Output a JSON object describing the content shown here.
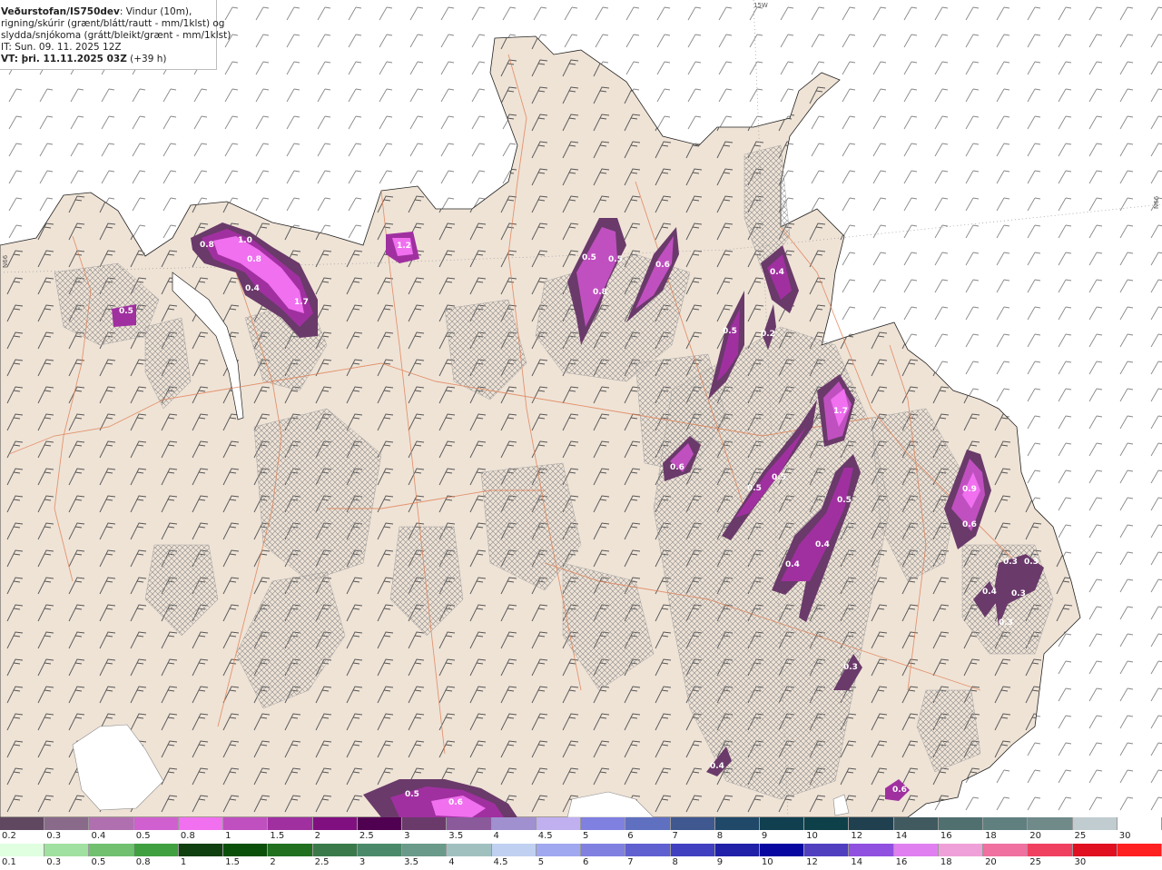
{
  "header": {
    "org": "Veðurstofan/IS750dev",
    "title_rest": ": Vindur (10m),",
    "line2": "rigning/skúrir (grænt/blátt/rautt - mm/1klst) og",
    "line3": "slydda/snjókoma (grátt/bleikt/grænt - mm/1klst)",
    "it": "IT: Sun. 09. 11. 2025 12Z",
    "vt_bold": "VT: þri. 11.11.2025 03Z",
    "vt_rest": " (+39 h)"
  },
  "lon_labels": {
    "top": "15W",
    "left": "N66",
    "right": "N66"
  },
  "colors": {
    "sea": "#ffffff",
    "land": "#efe3d6",
    "roads": "#e08055",
    "wind_barb": "#555555",
    "hatch": "#8a8a8a"
  },
  "precip_labels": [
    "0.8",
    "1.0",
    "0.8",
    "0.4",
    "1.7",
    "0.5",
    "1.2",
    "0.5",
    "0.5",
    "0.8",
    "0.6",
    "0.4",
    "0.2",
    "0.5",
    "1.7",
    "0.6",
    "0.5",
    "0.5",
    "0.5",
    "0.4",
    "0.4",
    "0.9",
    "0.6",
    "0.3",
    "0.3",
    "0.4",
    "0.3",
    "0.3",
    "0.3",
    "0.4",
    "0.6",
    "0.5",
    "0.6"
  ],
  "legend_snow": {
    "labels": [
      "0.2",
      "0.3",
      "0.4",
      "0.5",
      "0.8",
      "1",
      "1.5",
      "2",
      "2.5",
      "3",
      "3.5",
      "4",
      "4.5",
      "5",
      "6",
      "7",
      "8",
      "9",
      "10",
      "12",
      "14",
      "16",
      "18",
      "20",
      "25",
      "30"
    ],
    "colors": [
      "#604860",
      "#8a6a8a",
      "#b070b0",
      "#d060d0",
      "#f070f0",
      "#c050c0",
      "#a030a0",
      "#801080",
      "#500050",
      "#6a3a6a",
      "#8a5a9a",
      "#a090d0",
      "#c0b0f0",
      "#8080e0",
      "#6070c0",
      "#405890",
      "#204868",
      "#104050",
      "#0d4048",
      "#204050",
      "#405a60",
      "#507070",
      "#608080",
      "#708a8a",
      "#c0ccd0",
      "#ffffff"
    ]
  },
  "legend_rain": {
    "labels": [
      "0.1",
      "0.3",
      "0.5",
      "0.8",
      "1",
      "1.5",
      "2",
      "2.5",
      "3",
      "3.5",
      "4",
      "4.5",
      "5",
      "6",
      "7",
      "8",
      "9",
      "10",
      "12",
      "14",
      "16",
      "18",
      "20",
      "25",
      "30"
    ],
    "colors": [
      "#e0ffe0",
      "#a0e0a0",
      "#70c070",
      "#40a040",
      "#104010",
      "#0a500a",
      "#207020",
      "#3a7a4a",
      "#4a8a6a",
      "#6a9a8a",
      "#a0c0c0",
      "#c0d0f0",
      "#a0a8f0",
      "#8080e0",
      "#6060d0",
      "#4040c0",
      "#2020a8",
      "#0808a0",
      "#5040c0",
      "#9050e0",
      "#e080f0",
      "#f0a0d8",
      "#f070a0",
      "#f04060",
      "#e01020",
      "#ff2020"
    ]
  }
}
